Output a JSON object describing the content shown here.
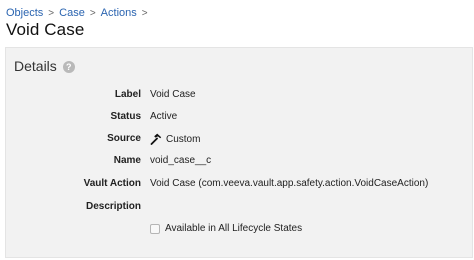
{
  "breadcrumb": {
    "items": [
      "Objects",
      "Case",
      "Actions"
    ],
    "separator": ">"
  },
  "page": {
    "title": "Void Case"
  },
  "details": {
    "title": "Details",
    "help_icon": "question-mark-icon",
    "fields": [
      {
        "label": "Label",
        "value": "Void Case"
      },
      {
        "label": "Status",
        "value": "Active"
      },
      {
        "label": "Source",
        "value": "Custom",
        "icon": "hammer-icon"
      },
      {
        "label": "Name",
        "value": "void_case__c"
      },
      {
        "label": "Vault Action",
        "value": "Void Case (com.veeva.vault.app.safety.action.VoidCaseAction)"
      },
      {
        "label": "Description",
        "value": ""
      }
    ],
    "lifecycle_checkbox": {
      "label": "Available in All Lifecycle States",
      "checked": false
    }
  },
  "colors": {
    "link": "#2a64b0",
    "panel_bg": "#f2f2f2"
  }
}
